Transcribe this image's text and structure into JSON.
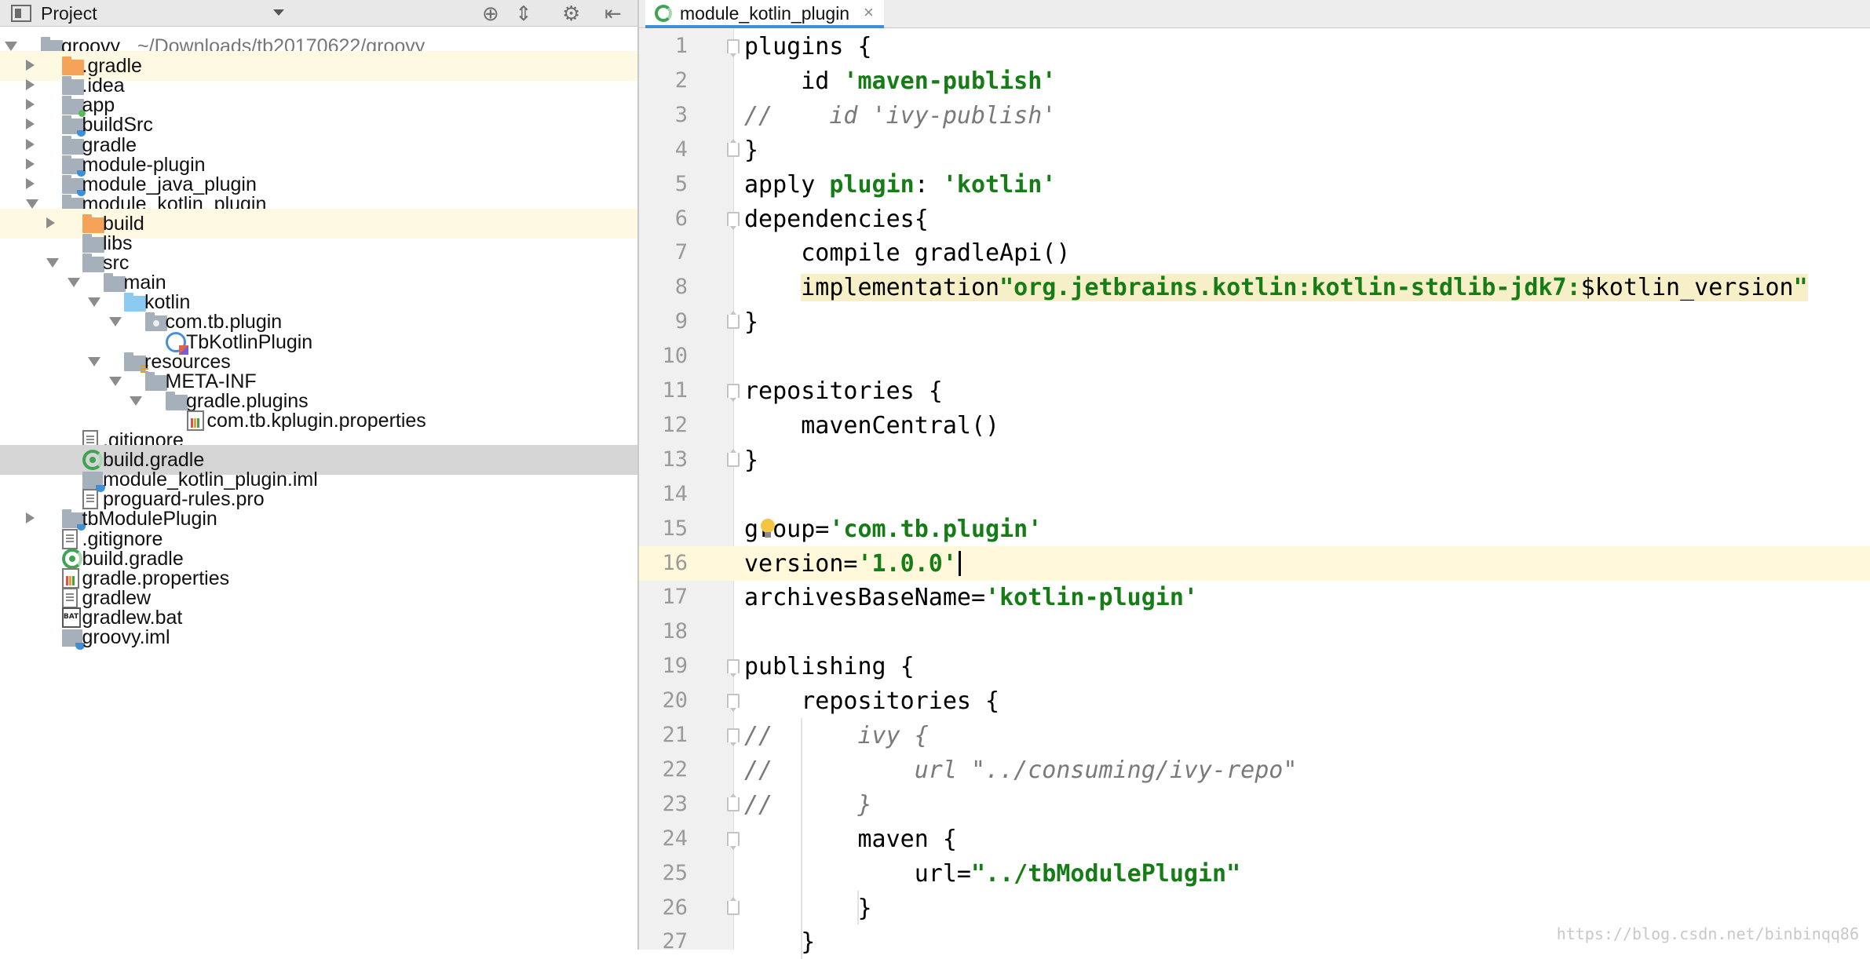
{
  "project_panel": {
    "title": "Project",
    "tree": [
      {
        "label": "groovy",
        "path": "~/Downloads/tb20170622/groovy",
        "depth": 0,
        "arrow": "down",
        "icon": "module-folder",
        "state": ""
      },
      {
        "label": ".gradle",
        "depth": 1,
        "arrow": "right",
        "icon": "folder-orange",
        "state": "highlight"
      },
      {
        "label": ".idea",
        "depth": 1,
        "arrow": "right",
        "icon": "folder",
        "state": ""
      },
      {
        "label": "app",
        "depth": 1,
        "arrow": "right",
        "icon": "app-module-folder",
        "state": ""
      },
      {
        "label": "buildSrc",
        "depth": 1,
        "arrow": "right",
        "icon": "module-folder",
        "state": ""
      },
      {
        "label": "gradle",
        "depth": 1,
        "arrow": "right",
        "icon": "folder",
        "state": ""
      },
      {
        "label": "module-plugin",
        "depth": 1,
        "arrow": "right",
        "icon": "module-folder",
        "state": ""
      },
      {
        "label": "module_java_plugin",
        "depth": 1,
        "arrow": "right",
        "icon": "module-folder",
        "state": ""
      },
      {
        "label": "module_kotlin_plugin",
        "depth": 1,
        "arrow": "down",
        "icon": "module-folder",
        "state": ""
      },
      {
        "label": "build",
        "depth": 2,
        "arrow": "right",
        "icon": "folder-orange",
        "state": "highlight"
      },
      {
        "label": "libs",
        "depth": 2,
        "arrow": "",
        "icon": "folder",
        "state": ""
      },
      {
        "label": "src",
        "depth": 2,
        "arrow": "down",
        "icon": "folder",
        "state": ""
      },
      {
        "label": "main",
        "depth": 3,
        "arrow": "down",
        "icon": "folder",
        "state": ""
      },
      {
        "label": "kotlin",
        "depth": 4,
        "arrow": "down",
        "icon": "folder-blue",
        "state": ""
      },
      {
        "label": "com.tb.plugin",
        "depth": 5,
        "arrow": "down",
        "icon": "package-folder",
        "state": ""
      },
      {
        "label": "TbKotlinPlugin",
        "depth": 6,
        "arrow": "",
        "icon": "kotlin-class",
        "state": ""
      },
      {
        "label": "resources",
        "depth": 4,
        "arrow": "down",
        "icon": "resources-folder",
        "state": ""
      },
      {
        "label": "META-INF",
        "depth": 5,
        "arrow": "down",
        "icon": "folder",
        "state": ""
      },
      {
        "label": "gradle.plugins",
        "depth": 6,
        "arrow": "down",
        "icon": "folder",
        "state": ""
      },
      {
        "label": "com.tb.kplugin.properties",
        "depth": 7,
        "arrow": "",
        "icon": "properties-file",
        "state": ""
      },
      {
        "label": ".gitignore",
        "depth": 2,
        "arrow": "",
        "icon": "text-file",
        "state": ""
      },
      {
        "label": "build.gradle",
        "depth": 2,
        "arrow": "",
        "icon": "gradle-file",
        "state": "selected"
      },
      {
        "label": "module_kotlin_plugin.iml",
        "depth": 2,
        "arrow": "",
        "icon": "iml-file",
        "state": ""
      },
      {
        "label": "proguard-rules.pro",
        "depth": 2,
        "arrow": "",
        "icon": "text-file",
        "state": ""
      },
      {
        "label": "tbModulePlugin",
        "depth": 1,
        "arrow": "right",
        "icon": "module-folder",
        "state": ""
      },
      {
        "label": ".gitignore",
        "depth": 1,
        "arrow": "",
        "icon": "text-file",
        "state": ""
      },
      {
        "label": "build.gradle",
        "depth": 1,
        "arrow": "",
        "icon": "gradle-file",
        "state": ""
      },
      {
        "label": "gradle.properties",
        "depth": 1,
        "arrow": "",
        "icon": "properties-file",
        "state": ""
      },
      {
        "label": "gradlew",
        "depth": 1,
        "arrow": "",
        "icon": "text-file",
        "state": ""
      },
      {
        "label": "gradlew.bat",
        "depth": 1,
        "arrow": "",
        "icon": "bat-file",
        "state": ""
      },
      {
        "label": "groovy.iml",
        "depth": 1,
        "arrow": "",
        "icon": "iml-file",
        "state": ""
      }
    ]
  },
  "editor": {
    "tab_label": "module_kotlin_plugin",
    "tab_close": "×",
    "current_line": 16,
    "lines": [
      {
        "n": "1",
        "fold": "open",
        "tokens": [
          [
            "t",
            "plugins {"
          ]
        ]
      },
      {
        "n": "2",
        "fold": "",
        "tokens": [
          [
            "t",
            "    id "
          ],
          [
            "s",
            "'maven-publish'"
          ]
        ]
      },
      {
        "n": "3",
        "fold": "",
        "tokens": [
          [
            "c",
            "//    id 'ivy-publish'"
          ]
        ]
      },
      {
        "n": "4",
        "fold": "close",
        "tokens": [
          [
            "t",
            "}"
          ]
        ]
      },
      {
        "n": "5",
        "fold": "",
        "tokens": [
          [
            "t",
            "apply "
          ],
          [
            "k",
            "plugin"
          ],
          [
            "t",
            ": "
          ],
          [
            "s",
            "'kotlin'"
          ]
        ]
      },
      {
        "n": "6",
        "fold": "open",
        "tokens": [
          [
            "t",
            "dependencies{"
          ]
        ]
      },
      {
        "n": "7",
        "fold": "",
        "tokens": [
          [
            "t",
            "    compile gradleApi()"
          ]
        ]
      },
      {
        "n": "8",
        "fold": "",
        "tokens": [
          [
            "t",
            "    "
          ],
          [
            "h",
            "implementation"
          ],
          [
            "hs",
            "\"org.jetbrains.kotlin:kotlin-stdlib-jdk7:"
          ],
          [
            "h",
            "$kotlin_version"
          ],
          [
            "hs",
            "\""
          ]
        ]
      },
      {
        "n": "9",
        "fold": "close",
        "tokens": [
          [
            "t",
            "}"
          ]
        ]
      },
      {
        "n": "10",
        "fold": "",
        "tokens": []
      },
      {
        "n": "11",
        "fold": "open",
        "tokens": [
          [
            "t",
            "repositories {"
          ]
        ]
      },
      {
        "n": "12",
        "fold": "",
        "tokens": [
          [
            "t",
            "    mavenCentral()"
          ]
        ]
      },
      {
        "n": "13",
        "fold": "close",
        "tokens": [
          [
            "t",
            "}"
          ]
        ]
      },
      {
        "n": "14",
        "fold": "",
        "tokens": []
      },
      {
        "n": "15",
        "fold": "",
        "tokens": [
          [
            "t",
            "group="
          ],
          [
            "s",
            "'com.tb.plugin'"
          ]
        ],
        "bulb": true
      },
      {
        "n": "16",
        "fold": "",
        "tokens": [
          [
            "t",
            "version="
          ],
          [
            "s",
            "'1.0.0'"
          ]
        ],
        "caret": true
      },
      {
        "n": "17",
        "fold": "",
        "tokens": [
          [
            "t",
            "archivesBaseName="
          ],
          [
            "s",
            "'kotlin-plugin'"
          ]
        ]
      },
      {
        "n": "18",
        "fold": "",
        "tokens": []
      },
      {
        "n": "19",
        "fold": "open",
        "tokens": [
          [
            "t",
            "publishing {"
          ]
        ]
      },
      {
        "n": "20",
        "fold": "open",
        "tokens": [
          [
            "t",
            "    repositories {"
          ]
        ]
      },
      {
        "n": "21",
        "fold": "open",
        "tokens": [
          [
            "c",
            "//      ivy {"
          ]
        ]
      },
      {
        "n": "22",
        "fold": "",
        "tokens": [
          [
            "c",
            "//          url "
          ],
          [
            "c2",
            "\""
          ],
          [
            "c",
            "../consuming/ivy-repo"
          ],
          [
            "c2",
            "\""
          ]
        ]
      },
      {
        "n": "23",
        "fold": "close",
        "tokens": [
          [
            "c",
            "//      }"
          ]
        ]
      },
      {
        "n": "24",
        "fold": "open",
        "tokens": [
          [
            "t",
            "        maven {"
          ]
        ]
      },
      {
        "n": "25",
        "fold": "",
        "tokens": [
          [
            "t",
            "            url="
          ],
          [
            "s",
            "\"../tbModulePlugin\""
          ]
        ]
      },
      {
        "n": "26",
        "fold": "close",
        "tokens": [
          [
            "t",
            "        }"
          ]
        ]
      },
      {
        "n": "27",
        "fold": "",
        "tokens": [
          [
            "t",
            "    }"
          ]
        ]
      }
    ]
  },
  "watermark": "https://blog.csdn.net/binbinqq86"
}
